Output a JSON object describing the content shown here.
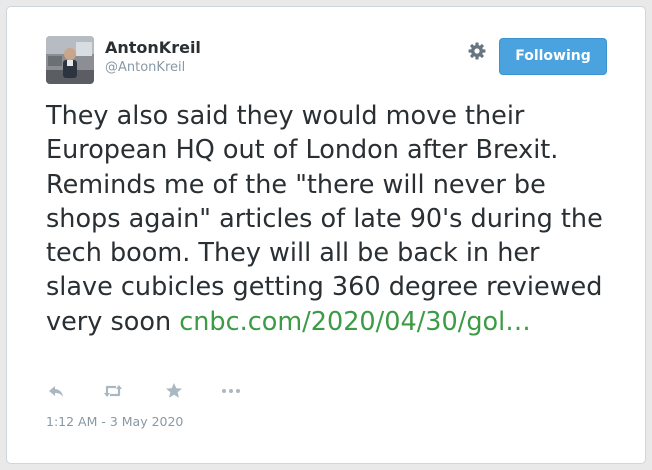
{
  "user": {
    "display_name": "AntonKreil",
    "handle": "@AntonKreil"
  },
  "follow_button": {
    "label": "Following"
  },
  "tweet": {
    "text": "They also said they would move their European HQ out of London after Brexit. Reminds me of the \"there will never be shops again\" articles of late 90's during the tech boom. They will all be back in her slave cubicles getting 360 degree reviewed very soon ",
    "link_text": "cnbc.com/2020/04/30/gol…",
    "timestamp": "1:12 AM - 3 May 2020"
  },
  "icons": {
    "settings": "gear-icon",
    "reply": "reply-icon",
    "retweet": "retweet-icon",
    "like": "star-icon",
    "more": "more-icon"
  },
  "colors": {
    "accent_button": "#4aa3df",
    "link": "#3c9b45",
    "muted": "#8899a6",
    "text": "#292f33",
    "icon": "#aab8c2"
  }
}
